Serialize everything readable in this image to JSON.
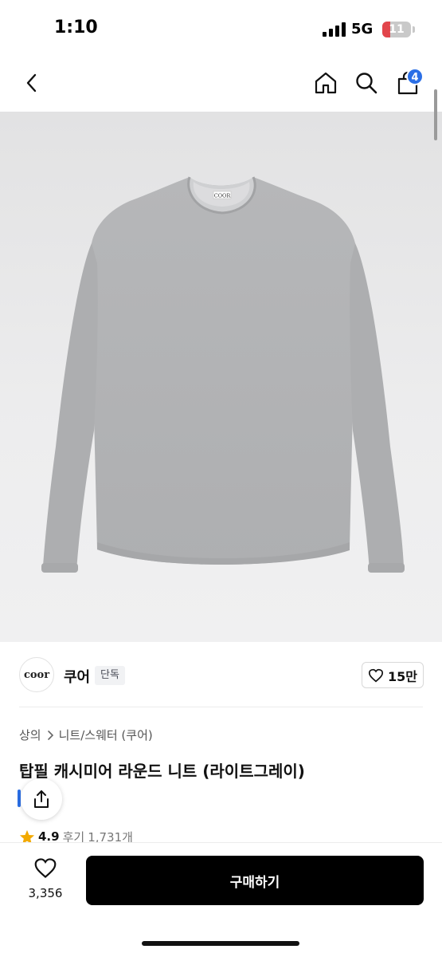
{
  "status_bar": {
    "time": "1:10",
    "network": "5G",
    "battery": "11",
    "battery_fraction": 0.11,
    "battery_color": "#e2454b"
  },
  "nav": {
    "back_icon": "chevron-left-icon",
    "home_icon": "home-icon",
    "search_icon": "search-icon",
    "cart_icon": "shopping-bag-icon",
    "cart_count": "4",
    "badge_color": "#2b6fe6"
  },
  "product_image": {
    "garment_tag": "COOR"
  },
  "brand": {
    "logo_text": "coor",
    "name": "쿠어",
    "badge": "단독",
    "likes": "15만",
    "like_icon": "heart-outline-icon"
  },
  "breadcrumb": {
    "category": "상의",
    "subcategory": "니트/스웨터 (쿠어)",
    "separator_icon": "chevron-right-icon"
  },
  "product": {
    "title": "탑필 캐시미어 라운드 니트 (라이트그레이)",
    "share_icon": "share-icon"
  },
  "rating": {
    "star_icon": "star-icon",
    "star_color": "#f2a900",
    "score": "4.9",
    "review_label": "후기",
    "review_count": "1,731개"
  },
  "bottom_bar": {
    "wish_icon": "heart-outline-icon",
    "wish_count": "3,356",
    "buy_label": "구매하기",
    "buy_color": "#000000"
  }
}
